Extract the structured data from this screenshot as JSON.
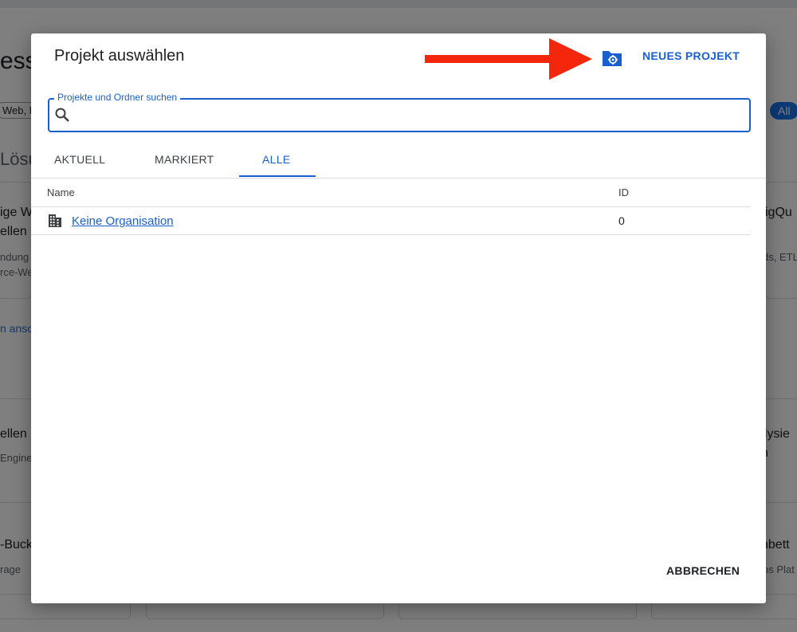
{
  "background": {
    "partial_texts": [
      {
        "text": "ess"
      },
      {
        "text": "Web, N"
      },
      {
        "text": "Lösu"
      },
      {
        "text": "ige W"
      },
      {
        "text": "ellen"
      },
      {
        "text": "ndung"
      },
      {
        "text": "rce-We"
      },
      {
        "text": "n ansc"
      },
      {
        "text": "ellen"
      },
      {
        "text": "Engine"
      },
      {
        "text": "-Buck"
      },
      {
        "text": "rage"
      },
      {
        "text": "igQu"
      },
      {
        "text": "ds, ETL"
      },
      {
        "text": "alysie"
      },
      {
        "text": "n"
      },
      {
        "text": "nbett"
      },
      {
        "text": "bs Plat"
      }
    ],
    "chip_all": "All"
  },
  "dialog": {
    "title": "Projekt auswählen",
    "new_project_label": "NEUES PROJEKT",
    "search": {
      "label": "Projekte und Ordner suchen",
      "value": ""
    },
    "tabs": [
      {
        "label": "AKTUELL",
        "active": false
      },
      {
        "label": "MARKIERT",
        "active": false
      },
      {
        "label": "ALLE",
        "active": true
      }
    ],
    "table": {
      "columns": [
        "Name",
        "ID"
      ],
      "rows": [
        {
          "name": "Keine Organisation",
          "id": "0"
        }
      ]
    },
    "cancel_label": "ABBRECHEN"
  },
  "colors": {
    "accent": "#1a5fd1",
    "arrow": "#f4270c",
    "scrim": "rgba(0,0,0,0.5)"
  },
  "icons": {
    "folder": "folder-settings-icon",
    "search": "search-icon",
    "org": "building-icon"
  }
}
